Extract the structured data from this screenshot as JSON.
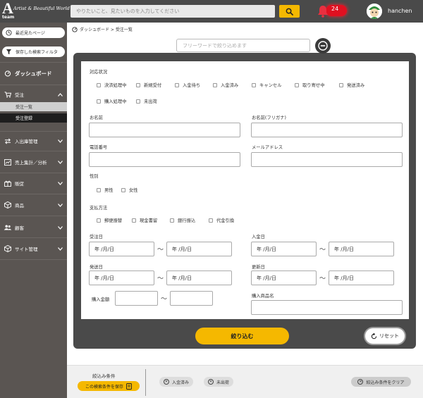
{
  "header": {
    "logo_letter": "A",
    "logo_sub": "team",
    "logo_tagline": "Artist & Beautiful World",
    "search_placeholder": "やりたいこと、見たいものを入力してください",
    "notification_count": "24",
    "username": "hanchen",
    "accent_color": "#f5b800"
  },
  "sidebar": {
    "recent_page": "最近見たページ",
    "saved_filter": "保存した検索フィルタ",
    "dashboard": "ダッシュボード",
    "orders": "受注",
    "order_list": "受注一覧",
    "order_register": "受注登録",
    "inventory": "入出庫管理",
    "sales": "売上集計／分析",
    "promotion": "販促",
    "products": "商品",
    "customers": "顧客",
    "site": "サイト管理"
  },
  "breadcrumb": "ダッシュボード > 受注一覧",
  "freeword_placeholder": "フリーワードで絞り込めます",
  "form": {
    "status_label": "対応状況",
    "status_options": [
      "決済処理中",
      "新規受付",
      "入金待ち",
      "入金済み",
      "キャンセル",
      "取り寄せ中",
      "発送済み",
      "購入処理中",
      "未出荷"
    ],
    "name_label": "お名前",
    "kana_label": "お名前(フリガナ)",
    "phone_label": "電話番号",
    "email_label": "メールアドレス",
    "gender_label": "性別",
    "gender_options": [
      "男性",
      "女性"
    ],
    "payment_label": "支払方法",
    "payment_options": [
      "郵便振替",
      "現金書留",
      "銀行振込",
      "代金引換"
    ],
    "order_date_label": "受注日",
    "payment_date_label": "入金日",
    "ship_date_label": "発送日",
    "update_date_label": "更新日",
    "amount_label": "購入金額",
    "product_name_label": "購入商品名",
    "date_placeholder": "年 /月/日",
    "tilde": "〜"
  },
  "buttons": {
    "submit": "絞り込む",
    "reset": "リセット",
    "save_condition": "この検索条件を保存",
    "clear_condition": "絞込み条件をクリア"
  },
  "conditions": {
    "title": "絞込み条件",
    "tags": [
      "入金済み",
      "未出荷"
    ]
  }
}
